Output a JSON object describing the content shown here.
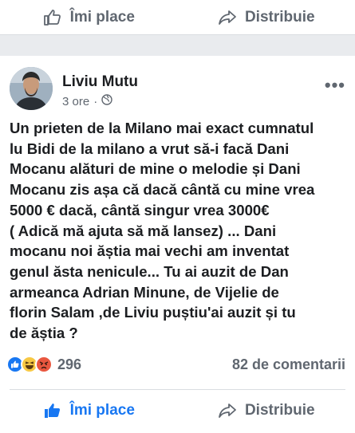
{
  "top_bar": {
    "like_label": "Îmi place",
    "share_label": "Distribuie"
  },
  "post": {
    "author": "Liviu Mutu",
    "time": "3 ore",
    "separator": "·",
    "privacy_icon": "globe-icon",
    "more_label": "•••",
    "text": "Un prieten de la Milano mai exact cumnatul\nlu Bidi de la milano a vrut să-i facă Dani\nMocanu alături de mine o melodie și Dani\nMocanu zis așa că dacă cântă cu mine vrea\n5000 € dacă, cântă singur vrea 3000€\n( Adică mă ajuta să mă lansez) ... Dani\nmocanu noi ăștia mai vechi am inventat\ngenul ăsta nenicule... Tu ai auzit de Dan\narmeanca Adrian Minune, de  Vijelie de\nflorin Salam ,de Liviu puștiu'ai auzit și tu\nde ăștia ?",
    "reactions": {
      "icons": [
        "like-reaction-icon",
        "haha-reaction-icon",
        "angry-reaction-icon"
      ],
      "count": "296",
      "comments": "82 de comentarii"
    }
  },
  "bottom_bar": {
    "like_label": "Îmi place",
    "share_label": "Distribuie"
  },
  "colors": {
    "like_active": "#1877f2",
    "muted": "#606770",
    "background": "#e9ebee"
  }
}
